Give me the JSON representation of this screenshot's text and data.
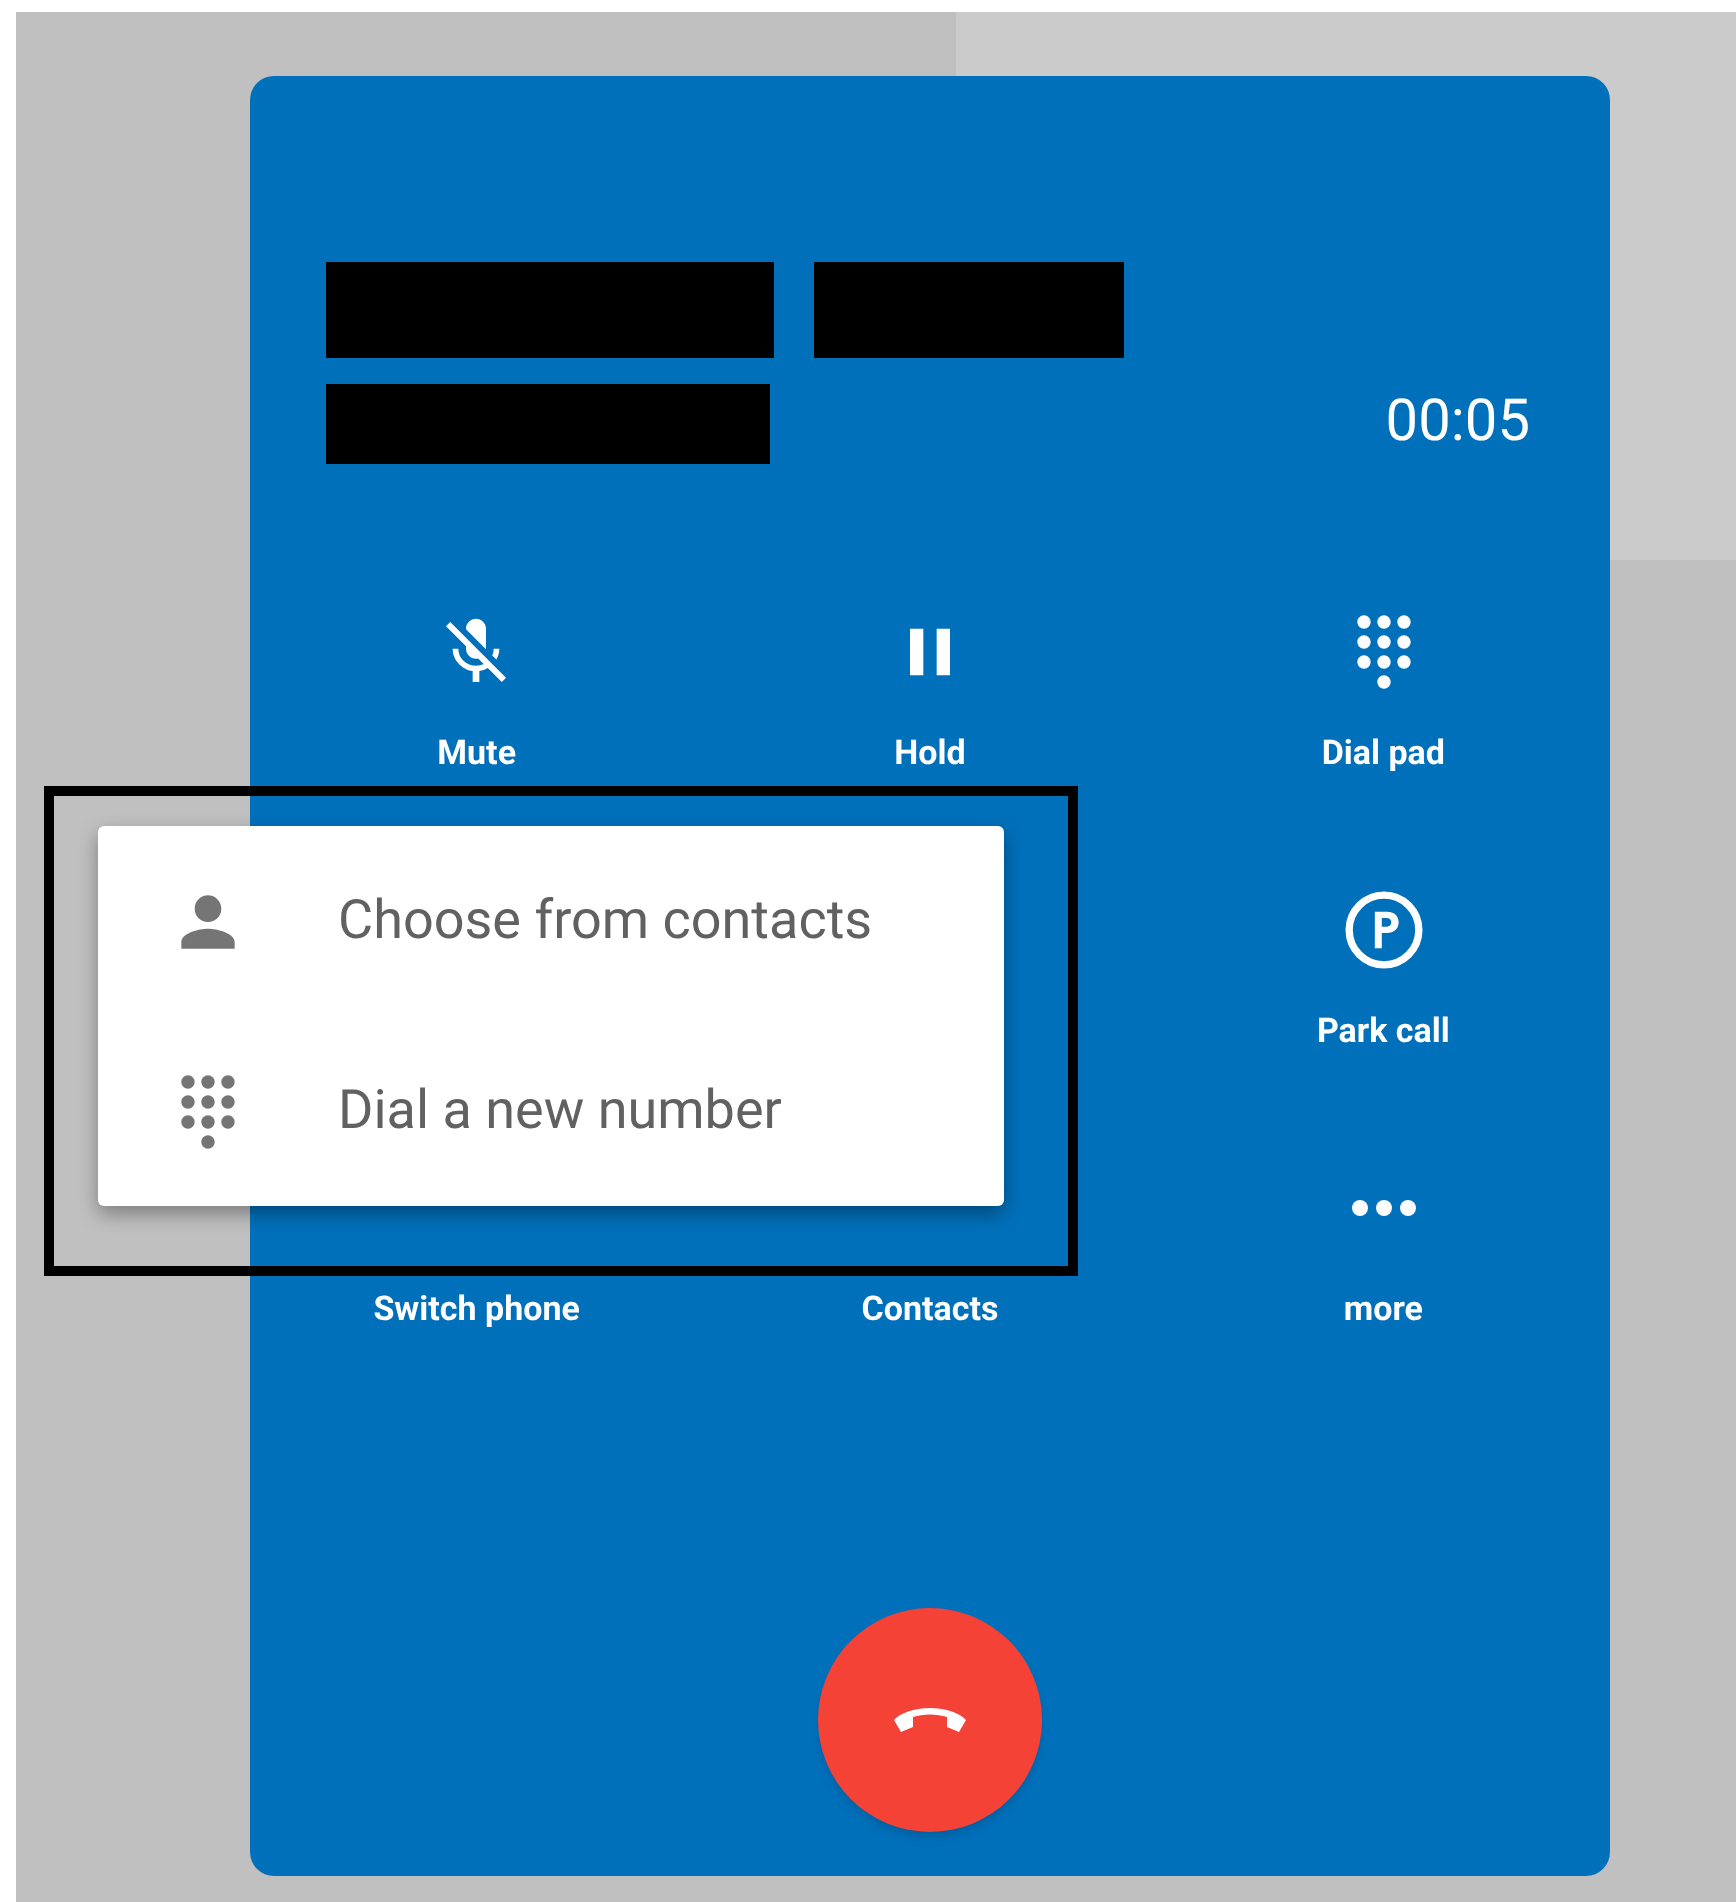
{
  "call": {
    "timer": "00:05"
  },
  "action_rows": [
    {
      "actions": [
        {
          "kind": "mute",
          "label": "Mute"
        },
        {
          "kind": "hold",
          "label": "Hold"
        },
        {
          "kind": "dialpad",
          "label": "Dial pad"
        }
      ]
    },
    {
      "actions": [
        {
          "kind": "park",
          "label": "Park call"
        }
      ]
    },
    {
      "actions": [
        {
          "kind": "none",
          "label": "Switch phone"
        },
        {
          "kind": "none",
          "label": "Contacts"
        },
        {
          "kind": "more",
          "label": "more"
        }
      ]
    }
  ],
  "menu": {
    "items": [
      {
        "kind": "person",
        "label": "Choose from contacts"
      },
      {
        "kind": "dialpad",
        "label": "Dial a new number"
      }
    ]
  }
}
